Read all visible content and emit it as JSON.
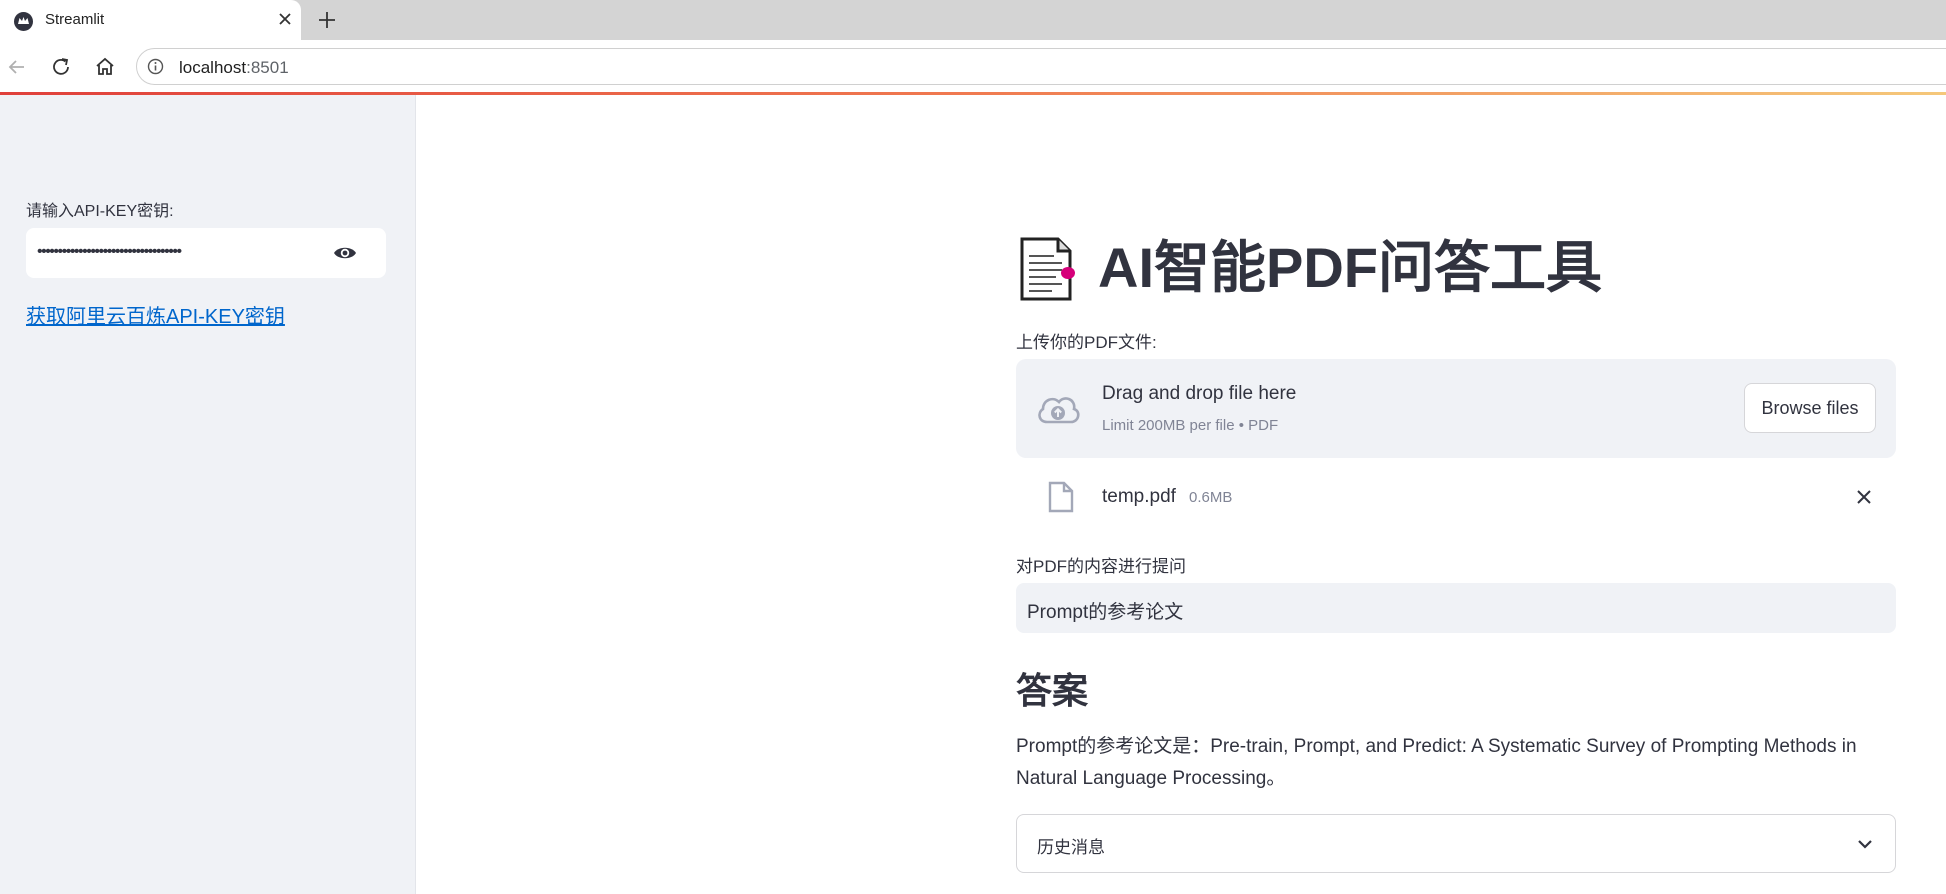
{
  "browser": {
    "tab_title": "Streamlit",
    "url_host": "localhost",
    "url_port": ":8501"
  },
  "sidebar": {
    "api_key_label": "请输入API-KEY密钥:",
    "api_key_masked": "•••••••••••••••••••••••••••••••••••",
    "link_text": "获取阿里云百炼API-KEY密钥"
  },
  "main": {
    "title": "AI智能PDF问答工具",
    "upload_label": "上传你的PDF文件:",
    "dropzone_text": "Drag and drop file here",
    "dropzone_limit": "Limit 200MB per file • PDF",
    "browse_label": "Browse files",
    "file_name": "temp.pdf",
    "file_size": "0.6MB",
    "question_label": "对PDF的内容进行提问",
    "question_value": "Prompt的参考论文",
    "answer_heading": "答案",
    "answer_text": "Prompt的参考论文是：Pre-train, Prompt, and Predict: A Systematic Survey of Prompting Methods in Natural Language Processing。",
    "history_label": "历史消息"
  },
  "colors": {
    "sidebar_bg": "#f0f2f6",
    "text": "#31333f",
    "link": "#0066cc",
    "muted": "#808495"
  }
}
